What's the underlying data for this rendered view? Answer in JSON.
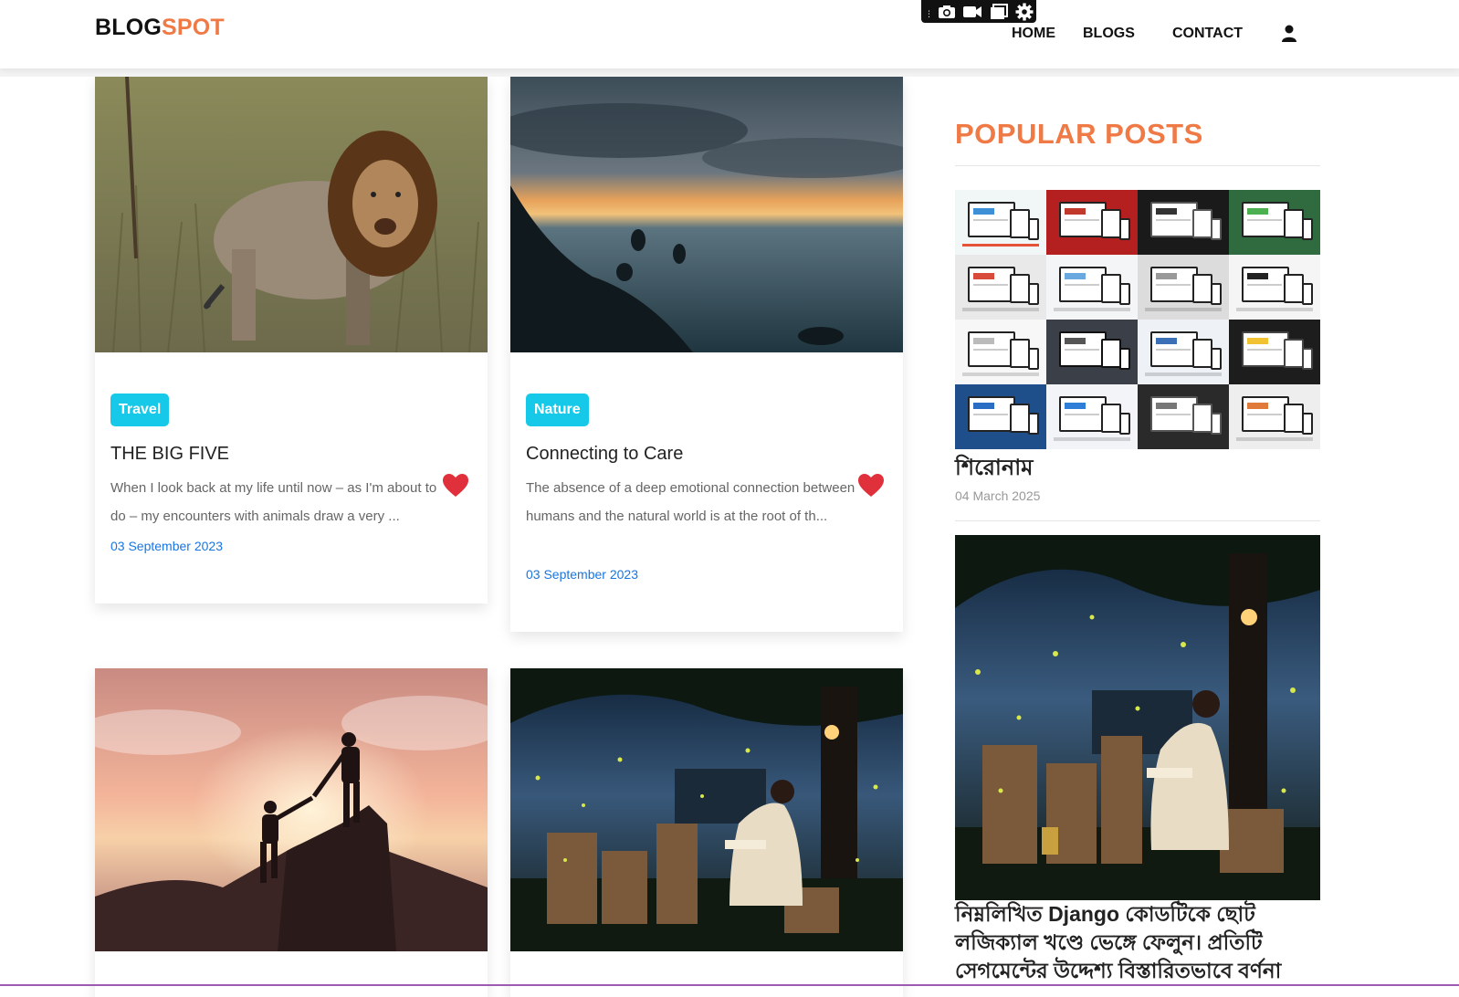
{
  "brand": {
    "part1": "BLOG",
    "part2": "SPOT",
    "accent": "#f07a45"
  },
  "nav": {
    "home": "HOME",
    "blogs": "BLOGS",
    "contact": "CONTACT"
  },
  "toolbar_icons": [
    "camera-icon",
    "video-icon",
    "window-icon",
    "settings-icon"
  ],
  "posts": [
    {
      "category": "Travel",
      "title": "THE BIG FIVE",
      "excerpt": "When I look back at my life until now – as I'm about to do – my encounters with animals draw a very ...",
      "date": "03 September 2023"
    },
    {
      "category": "Nature",
      "title": "Connecting to Care",
      "excerpt": "The absence of a deep emotional connection between humans and the natural world is at the root of th...",
      "date": "03 September 2023"
    }
  ],
  "sidebar": {
    "heading": "POPULAR POSTS",
    "items": [
      {
        "title": "শিরোনাম",
        "date": "04 March 2025"
      },
      {
        "title": "নিম্নলিখিত Django কোডটিকে ছোট লজিক্যাল খণ্ডে ভেঙ্গে ফেলুন। প্রতিটি সেগমেন্টের উদ্দেশ্য বিস্তারিতভাবে বর্ণনা"
      }
    ]
  },
  "colors": {
    "badge": "#16c9e8",
    "date": "#1976e0",
    "heart": "#e0303c"
  }
}
